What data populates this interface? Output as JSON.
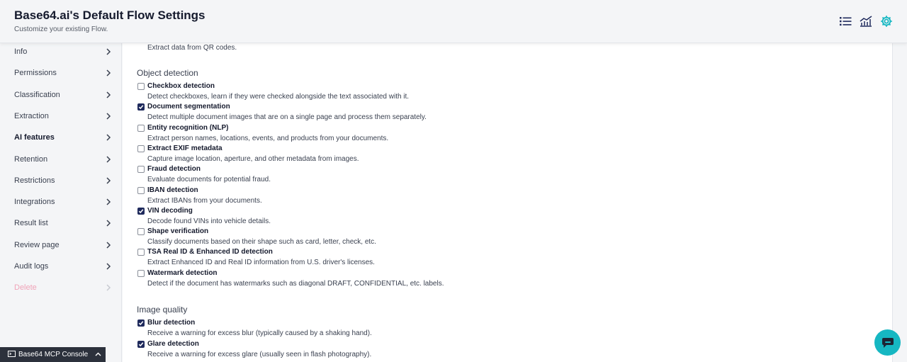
{
  "header": {
    "title": "Base64.ai's Default Flow Settings",
    "subtitle": "Customize your existing Flow.",
    "icons": [
      "list-icon",
      "analytics-icon",
      "gear-icon"
    ],
    "accent_color": "#16b7c2"
  },
  "sidebar": {
    "items": [
      {
        "label": "Info"
      },
      {
        "label": "Permissions"
      },
      {
        "label": "Classification"
      },
      {
        "label": "Extraction"
      },
      {
        "label": "AI features",
        "active": true
      },
      {
        "label": "Retention"
      },
      {
        "label": "Restrictions"
      },
      {
        "label": "Integrations"
      },
      {
        "label": "Result list"
      },
      {
        "label": "Review page"
      },
      {
        "label": "Audit logs"
      },
      {
        "label": "Delete",
        "danger": true
      }
    ]
  },
  "main": {
    "truncated_desc": "Extract data from QR codes.",
    "object_detection": {
      "title": "Object detection",
      "options": [
        {
          "label": "Checkbox detection",
          "desc": "Detect checkboxes, learn if they were checked alongside the text associated with it.",
          "checked": false
        },
        {
          "label": "Document segmentation",
          "desc": "Detect multiple document images that are on a single page and process them separately.",
          "checked": true
        },
        {
          "label": "Entity recognition (NLP)",
          "desc": "Extract person names, locations, events, and products from your documents.",
          "checked": false
        },
        {
          "label": "Extract EXIF metadata",
          "desc": "Capture image location, aperture, and other metadata from images.",
          "checked": false
        },
        {
          "label": "Fraud detection",
          "desc": "Evaluate documents for potential fraud.",
          "checked": false
        },
        {
          "label": "IBAN detection",
          "desc": "Extract IBANs from your documents.",
          "checked": false
        },
        {
          "label": "VIN decoding",
          "desc": "Decode found VINs into vehicle details.",
          "checked": true
        },
        {
          "label": "Shape verification",
          "desc": "Classify documents based on their shape such as card, letter, check, etc.",
          "checked": false
        },
        {
          "label": "TSA Real ID & Enhanced ID detection",
          "desc": "Extract Enhanced ID and Real ID information from U.S. driver's licenses.",
          "checked": false
        },
        {
          "label": "Watermark detection",
          "desc": "Detect if the document has watermarks such as diagonal DRAFT, CONFIDENTIAL, etc. labels.",
          "checked": false
        }
      ]
    },
    "image_quality": {
      "title": "Image quality",
      "options": [
        {
          "label": "Blur detection",
          "desc": "Receive a warning for excess blur (typically caused by a shaking hand).",
          "checked": true
        },
        {
          "label": "Glare detection",
          "desc": "Receive a warning for excess glare (usually seen in flash photography).",
          "checked": true
        }
      ]
    }
  },
  "console": {
    "label": "Base64 MCP Console"
  },
  "chat": {
    "icon": "chat-icon"
  }
}
